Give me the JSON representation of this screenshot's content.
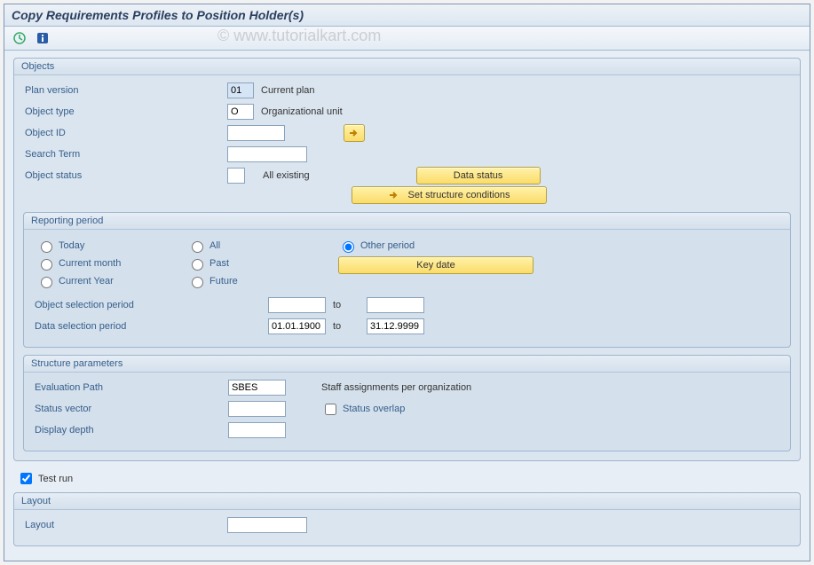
{
  "window": {
    "title": "Copy Requirements Profiles to Position Holder(s)"
  },
  "watermark": "© www.tutorialkart.com",
  "objects": {
    "title": "Objects",
    "plan_version_label": "Plan version",
    "plan_version_value": "01",
    "plan_version_desc": "Current plan",
    "object_type_label": "Object type",
    "object_type_value": "O",
    "object_type_desc": "Organizational unit",
    "object_id_label": "Object ID",
    "object_id_value": "",
    "search_term_label": "Search Term",
    "search_term_value": "",
    "object_status_label": "Object status",
    "object_status_value": "",
    "object_status_desc": "All existing",
    "data_status_btn": "Data status",
    "set_structure_btn": "Set structure conditions"
  },
  "reporting": {
    "title": "Reporting period",
    "today": "Today",
    "all": "All",
    "other_period": "Other period",
    "current_month": "Current month",
    "past": "Past",
    "key_date_btn": "Key date",
    "current_year": "Current Year",
    "future": "Future",
    "obj_sel_period_label": "Object selection period",
    "obj_sel_from": "",
    "obj_sel_to": "",
    "data_sel_period_label": "Data selection period",
    "data_sel_from": "01.01.1900",
    "data_sel_to": "31.12.9999",
    "to": "to"
  },
  "structure": {
    "title": "Structure parameters",
    "eval_path_label": "Evaluation Path",
    "eval_path_value": "SBES",
    "eval_path_desc": "Staff assignments per organization",
    "status_vector_label": "Status vector",
    "status_vector_value": "",
    "status_overlap_label": "Status overlap",
    "display_depth_label": "Display depth",
    "display_depth_value": ""
  },
  "test_run_label": "Test run",
  "layout": {
    "title": "Layout",
    "label": "Layout",
    "value": ""
  }
}
